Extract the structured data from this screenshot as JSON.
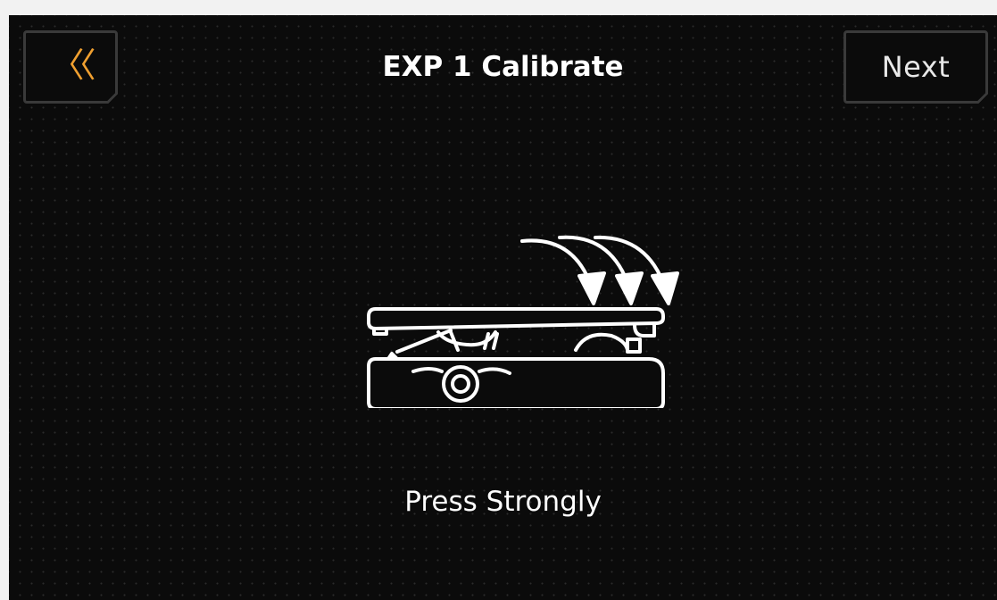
{
  "header": {
    "title": "EXP 1 Calibrate",
    "back_icon": "double-chevron-left-icon",
    "back_glyph": "〈〈",
    "next_label": "Next"
  },
  "main": {
    "illustration_icon": "expression-pedal-press-icon",
    "instruction": "Press Strongly"
  },
  "colors": {
    "background": "#0b0b0b",
    "accent": "#f0a030",
    "text": "#ffffff",
    "button_border": "#3a3a3a"
  }
}
